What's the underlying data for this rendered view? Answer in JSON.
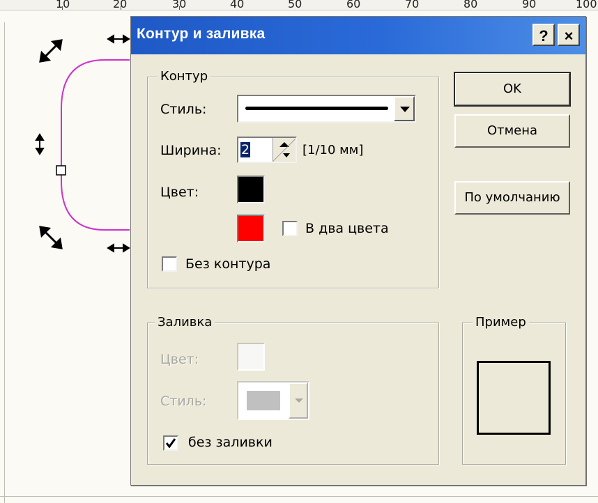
{
  "ruler": {
    "ticks": [
      "10",
      "20",
      "30",
      "40",
      "50",
      "60",
      "70",
      "80",
      "90",
      "100"
    ]
  },
  "dialog": {
    "title": "Контур и заливка",
    "help_label": "?",
    "close_label": "×",
    "outline": {
      "group_label": "Контур",
      "style_label": "Стиль:",
      "width_label": "Ширина:",
      "width_value": "2",
      "width_unit": "[1/10 мм]",
      "color_label": "Цвет:",
      "color_primary": "#000000",
      "color_secondary": "#ff0000",
      "two_colors_label": "В два цвета",
      "two_colors_checked": false,
      "no_outline_label": "Без контура",
      "no_outline_checked": false
    },
    "fill": {
      "group_label": "Заливка",
      "color_label": "Цвет:",
      "style_label": "Стиль:",
      "no_fill_label": "без заливки",
      "no_fill_checked": true
    },
    "preview": {
      "group_label": "Пример"
    },
    "buttons": {
      "ok": "OK",
      "cancel": "Отмена",
      "default": "По умолчанию"
    }
  },
  "colors": {
    "title_bar": "#2a6ad8",
    "shape_stroke": "#cc33cc"
  }
}
